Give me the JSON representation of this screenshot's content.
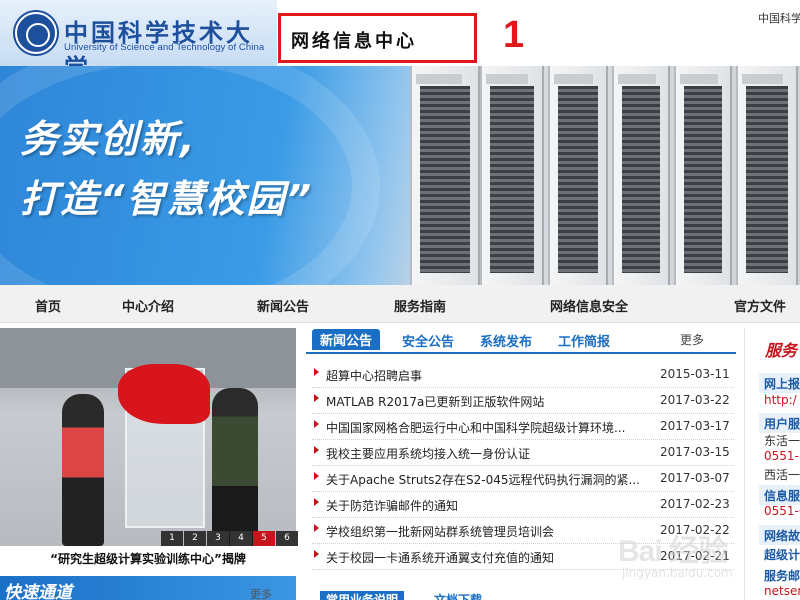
{
  "header": {
    "university_cn": "中国科学技术大学",
    "university_en": "University of Science and Technology of China",
    "center_title": "网络信息中心",
    "annotation_number": "1",
    "top_link": "中国科学"
  },
  "banner": {
    "slogan_line1": "务实创新,",
    "slogan_line2": "打造“智慧校园”"
  },
  "nav": {
    "items": [
      "首页",
      "中心介绍",
      "新闻公告",
      "服务指南",
      "网络信息安全",
      "官方文件"
    ]
  },
  "photo": {
    "caption": "“研究生超级计算实验训练中心”揭牌",
    "slides": [
      "1",
      "2",
      "3",
      "4",
      "5",
      "6"
    ],
    "active_slide": 5
  },
  "quick_access": {
    "title": "快速通道",
    "more": "更多"
  },
  "news": {
    "tabs": [
      "新闻公告",
      "安全公告",
      "系统发布",
      "工作简报"
    ],
    "active_tab": 0,
    "more": "更多",
    "items": [
      {
        "title": "超算中心招聘启事",
        "date": "2015-03-11"
      },
      {
        "title": "MATLAB R2017a已更新到正版软件网站",
        "date": "2017-03-22"
      },
      {
        "title": "中国国家网格合肥运行中心和中国科学院超级计算环境...",
        "date": "2017-03-17"
      },
      {
        "title": "我校主要应用系统均接入统一身份认证",
        "date": "2017-03-15"
      },
      {
        "title": "关于Apache Struts2存在S2-045远程代码执行漏洞的紧...",
        "date": "2017-03-07"
      },
      {
        "title": "关于防范诈骗邮件的通知",
        "date": "2017-02-23"
      },
      {
        "title": "学校组织第一批新网站群系统管理员培训会",
        "date": "2017-02-22"
      },
      {
        "title": "关于校园一卡通系统开通翼支付充值的通知",
        "date": "2017-02-21"
      }
    ],
    "bottom_tabs": [
      "常用业务说明",
      "文档下载"
    ]
  },
  "right_column": {
    "title": "服务",
    "items": [
      {
        "text": "网上报",
        "style": "blue"
      },
      {
        "text": "http:/",
        "style": "red"
      },
      {
        "text": "用户服",
        "style": "blue"
      },
      {
        "text": "东活一",
        "style": "plain"
      },
      {
        "text": "0551-",
        "style": "red"
      },
      {
        "text": "西活一",
        "style": "plain"
      },
      {
        "text": "信息服",
        "style": "blue"
      },
      {
        "text": "0551-6",
        "style": "red"
      },
      {
        "text": "网络故",
        "style": "blue"
      },
      {
        "text": "超级计",
        "style": "blue"
      },
      {
        "text": "服务邮",
        "style": "blue"
      },
      {
        "text": "netser",
        "style": "red"
      }
    ]
  },
  "watermark": {
    "text": "Bai 经验",
    "sub": "jingyan.baidu.com"
  },
  "colors": {
    "brand_blue": "#1d4f9c",
    "accent_blue": "#1a6fc4",
    "accent_red": "#c8141c",
    "annotation_red": "#e0191b"
  }
}
